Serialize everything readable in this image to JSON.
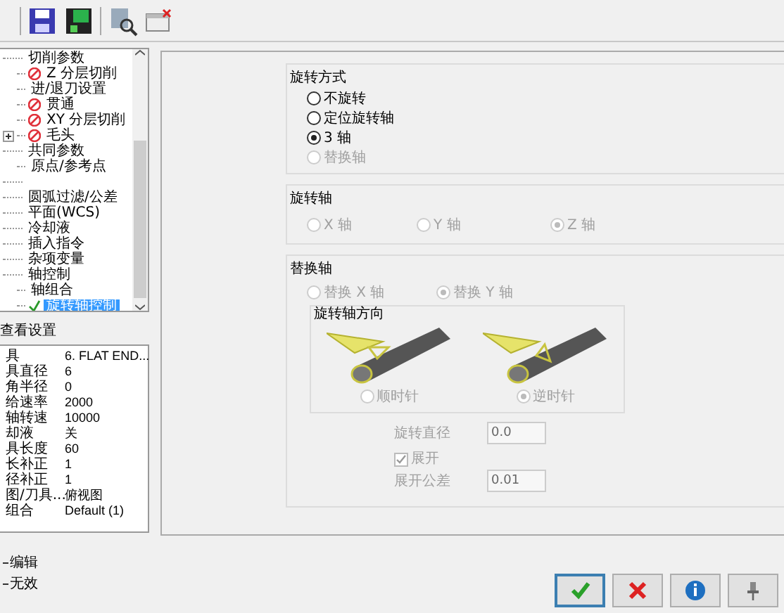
{
  "toolbar": {
    "buttons": [
      {
        "kind": "save"
      },
      {
        "kind": "save-green"
      },
      {
        "kind": "find"
      },
      {
        "kind": "edit"
      }
    ]
  },
  "tree": {
    "items": [
      {
        "label": "切削参数",
        "expanded": true,
        "children": [
          {
            "label": "Z 分层切削",
            "kind": "error"
          },
          {
            "label": "进/退刀设置"
          },
          {
            "label": "贯通",
            "kind": "error"
          },
          {
            "label": "XY 分层切削",
            "kind": "error"
          },
          {
            "label": "毛头",
            "kind": "error",
            "expanded": false
          }
        ]
      },
      {
        "label": "共同参数",
        "expanded": true,
        "children": [
          {
            "label": "原点/参考点"
          }
        ]
      },
      {
        "label": "圆弧过滤/公差"
      },
      {
        "label": "平面(WCS)"
      },
      {
        "label": "冷却液"
      },
      {
        "label": "插入指令"
      },
      {
        "label": "杂项变量"
      },
      {
        "label": "轴控制",
        "expanded": true,
        "children": [
          {
            "label": "轴组合"
          },
          {
            "label": "旋转轴控制",
            "kind": "done",
            "selected": true
          }
        ]
      }
    ]
  },
  "quick_view": {
    "title": "查看设置",
    "rows": [
      {
        "label": "具",
        "value": "6. FLAT END..."
      },
      {
        "label": "具直径",
        "value": "6"
      },
      {
        "label": "角半径",
        "value": "0"
      },
      {
        "label": "给速率",
        "value": "2000"
      },
      {
        "label": "轴转速",
        "value": "10000"
      },
      {
        "label": "却液",
        "value": "关"
      },
      {
        "label": "具长度",
        "value": "60"
      },
      {
        "label": "长补正",
        "value": "1"
      },
      {
        "label": "径补正",
        "value": "1"
      },
      {
        "label": "图/刀具...",
        "value": "俯视图"
      },
      {
        "label": "组合",
        "value": "Default (1)"
      }
    ]
  },
  "legend": [
    "编辑",
    "无效"
  ],
  "rotation_type": {
    "title": "旋转方式",
    "options": [
      {
        "label": "不旋转",
        "selected": false,
        "disabled": false
      },
      {
        "label": "定位旋转轴",
        "selected": false,
        "disabled": false
      },
      {
        "label": "3 轴",
        "selected": true,
        "disabled": false
      },
      {
        "label": "替换轴",
        "selected": false,
        "disabled": true
      }
    ]
  },
  "rotation_axis": {
    "title": "旋转轴",
    "options": [
      {
        "label": "X 轴",
        "selected": false,
        "disabled": true
      },
      {
        "label": "Y 轴",
        "selected": false,
        "disabled": true
      },
      {
        "label": "Z 轴",
        "selected": true,
        "disabled": true
      }
    ]
  },
  "replace_axis": {
    "title": "替换轴",
    "options": [
      {
        "label": "替换 X 轴",
        "selected": false,
        "disabled": true
      },
      {
        "label": "替换 Y 轴",
        "selected": true,
        "disabled": true
      }
    ],
    "direction": {
      "title": "旋转轴方向",
      "options": [
        {
          "label": "顺时针",
          "selected": false,
          "disabled": true
        },
        {
          "label": "逆时针",
          "selected": true,
          "disabled": true
        }
      ]
    },
    "diameter": {
      "label": "旋转直径",
      "value": "0.0"
    },
    "unroll": {
      "label": "展开",
      "checked": true,
      "disabled": true
    },
    "unroll_tolerance": {
      "label": "展开公差",
      "value": "0.01"
    }
  },
  "dialog_buttons": [
    {
      "kind": "ok",
      "selected": true
    },
    {
      "kind": "cancel",
      "selected": false
    },
    {
      "kind": "help",
      "selected": false
    },
    {
      "kind": "pin",
      "selected": false
    }
  ]
}
